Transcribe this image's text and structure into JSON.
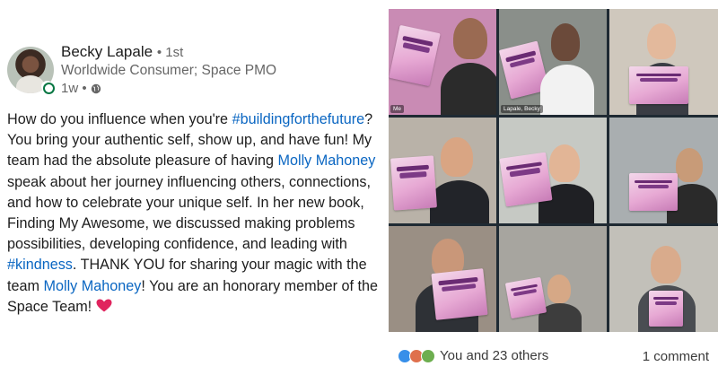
{
  "post": {
    "author_name": "Becky Lapale",
    "connection_degree": "• 1st",
    "headline": "Worldwide Consumer; Space PMO",
    "timestamp": "1w •",
    "text": {
      "p1": "How do you influence when you're ",
      "hashtag1": "#buildingforthefuture",
      "p2": "? You bring your authentic self, show up, and have fun! My team had the absolute pleasure of having ",
      "mention1": "Molly Mahoney",
      "p3": " speak about her journey influencing others, connections, and how to celebrate your unique self. In her new book, Finding My Awesome, we discussed making problems possibilities, developing confidence, and leading with ",
      "hashtag2": "#kindness",
      "p4": ". THANK YOU for sharing your magic with the team ",
      "mention2": "Molly Mahoney",
      "p5": "! You are an honorary member of the Space Team! "
    }
  },
  "video_grid": {
    "tiles": [
      {
        "name": "Me",
        "bg": "#c98bb4"
      },
      {
        "name": "Lapale, Becky",
        "bg": "#8a8f8a"
      },
      {
        "name": "",
        "bg": "#cfc8bd"
      },
      {
        "name": "",
        "bg": "#b9b2a8"
      },
      {
        "name": "",
        "bg": "#c6c9c4"
      },
      {
        "name": "",
        "bg": "#a9aeb0"
      },
      {
        "name": "",
        "bg": "#9a8f84"
      },
      {
        "name": "",
        "bg": "#a7a59f"
      },
      {
        "name": "",
        "bg": "#c2c0b9"
      }
    ]
  },
  "social": {
    "reactions_label": "You and 23 others",
    "comments_label": "1 comment"
  },
  "colors": {
    "link": "#0a66c2",
    "like": "#378fe9",
    "love": "#df704d",
    "support": "#6dae4f"
  },
  "icons": [
    "globe-icon",
    "heart-icon",
    "like-reaction-icon",
    "love-reaction-icon",
    "support-reaction-icon"
  ]
}
